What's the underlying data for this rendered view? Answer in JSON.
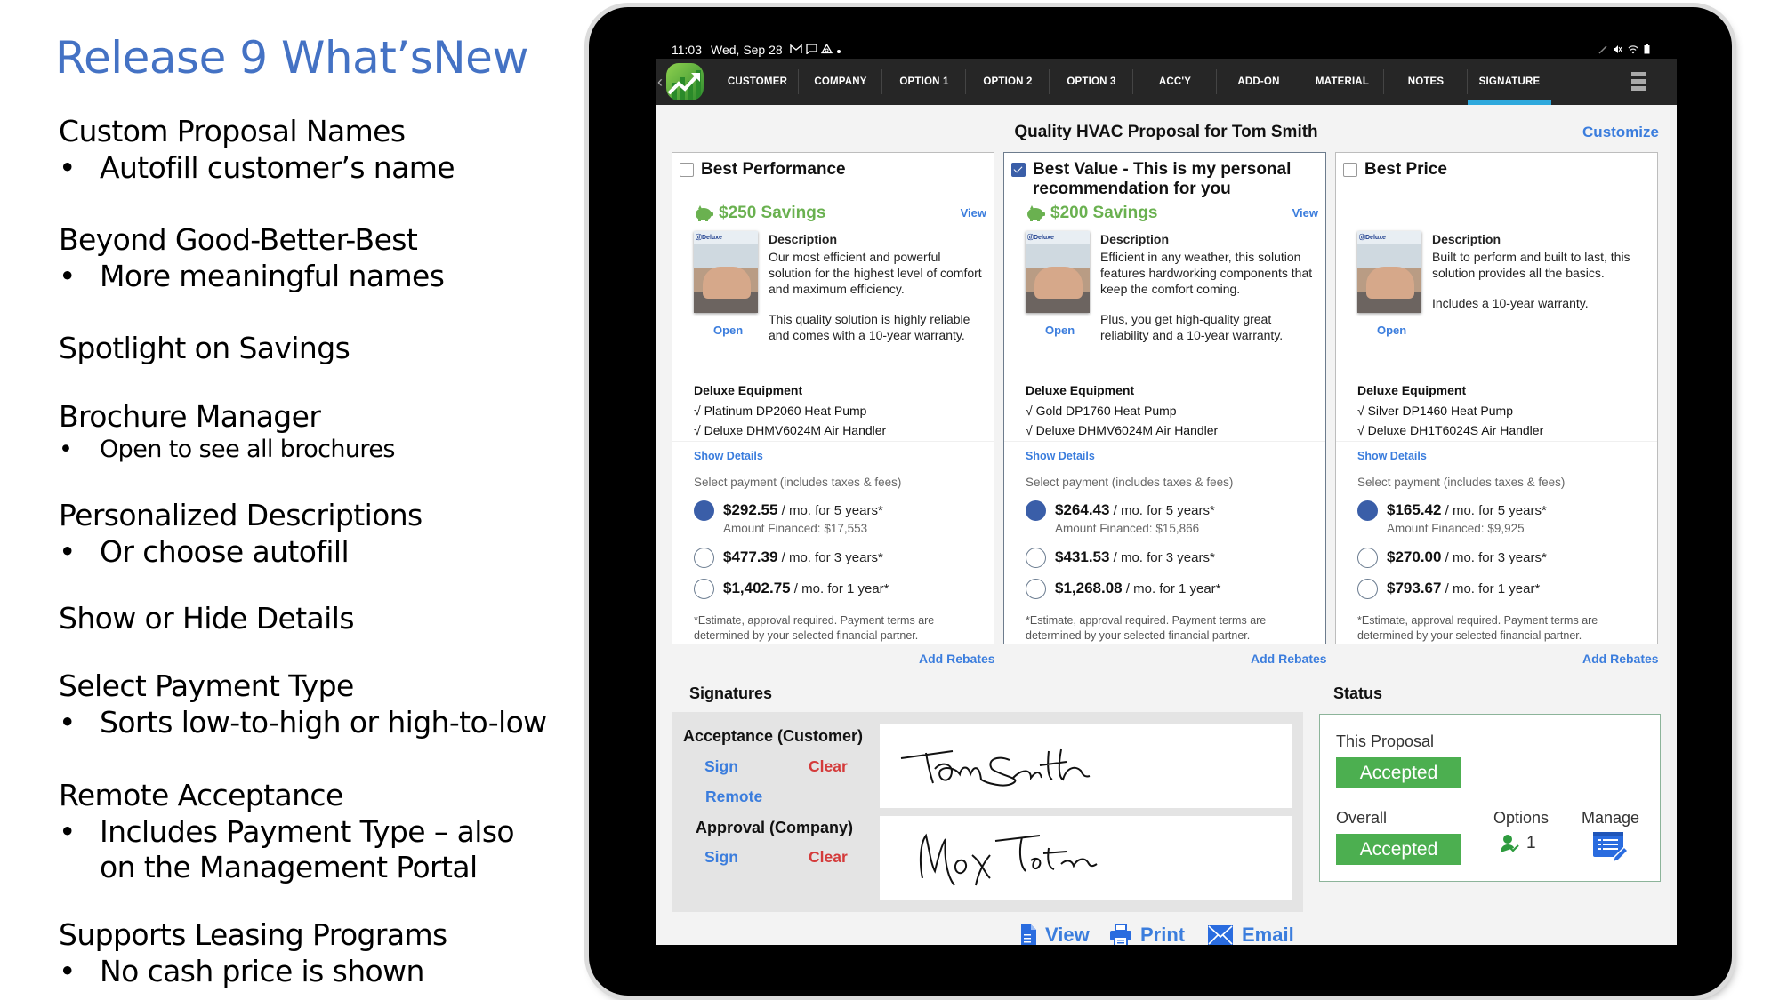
{
  "slide": {
    "title": "Release 9 What’sNew",
    "features": [
      {
        "heading": "Custom Proposal Names",
        "bullets": [
          "Autofill customer’s name"
        ]
      },
      {
        "heading": "Beyond Good-Better-Best",
        "bullets": [
          "More meaningful names"
        ]
      },
      {
        "heading": "Spotlight on Savings",
        "bullets": []
      },
      {
        "heading": "Brochure Manager",
        "bullets": [
          "Open to see all brochures"
        ]
      },
      {
        "heading": "Personalized Descriptions",
        "bullets": [
          "Or choose autofill"
        ]
      },
      {
        "heading": "Show or Hide Details",
        "bullets": []
      },
      {
        "heading": "Select Payment Type",
        "bullets": [
          "Sorts low-to-high or high-to-low"
        ]
      },
      {
        "heading": "Remote Acceptance",
        "bullets": [
          "Includes Payment Type – also on the Management Portal"
        ]
      },
      {
        "heading": "Supports Leasing Programs",
        "bullets": [
          "No cash price is shown"
        ]
      }
    ],
    "bullet_char": "•"
  },
  "device": {
    "status_bar": {
      "time": "11:03",
      "date": "Wed, Sep 28",
      "left_icons": [
        "gmail-icon",
        "message-icon",
        "drive-icon",
        "dot-icon"
      ],
      "right_icons": [
        "pen-icon",
        "mute-icon",
        "wifi-icon",
        "battery-icon"
      ]
    }
  },
  "app": {
    "nav": {
      "back_glyph": "‹",
      "tabs": [
        {
          "label": "CUSTOMER",
          "active": false
        },
        {
          "label": "COMPANY",
          "active": false
        },
        {
          "label": "OPTION 1",
          "active": false
        },
        {
          "label": "OPTION 2",
          "active": false
        },
        {
          "label": "OPTION 3",
          "active": false
        },
        {
          "label": "ACC'Y",
          "active": false
        },
        {
          "label": "ADD-ON",
          "active": false
        },
        {
          "label": "MATERIAL",
          "active": false
        },
        {
          "label": "NOTES",
          "active": false
        },
        {
          "label": "SIGNATURE",
          "active": true
        }
      ],
      "accent_color": "#2ea8dc"
    },
    "proposal_title": "Quality HVAC Proposal for Tom Smith",
    "customize_label": "Customize",
    "common": {
      "view_label": "View",
      "open_label": "Open",
      "description_heading": "Description",
      "equipment_heading": "Deluxe Equipment",
      "show_details_label": "Show Details",
      "select_payment_label": "Select payment (includes taxes & fees)",
      "estimate_note": "*Estimate, approval required. Payment terms are determined by your selected financial partner.",
      "add_rebates_label": "Add Rebates",
      "check_glyph": "√"
    },
    "options": [
      {
        "name": "Best Performance",
        "checked": false,
        "savings": "$250 Savings",
        "description": [
          "Our most efficient and powerful solution for the highest level of comfort and maximum efficiency.",
          "This quality solution is highly reliable and comes with a 10-year warranty."
        ],
        "equipment": [
          "Platinum DP2060 Heat Pump",
          "Deluxe DHMV6024M Air Handler"
        ],
        "payments": [
          {
            "amount": "$292.55",
            "term": " / mo. for 5 years*",
            "financed": "Amount Financed: $17,553",
            "selected": true
          },
          {
            "amount": "$477.39",
            "term": " / mo. for 3 years*",
            "financed": "",
            "selected": false
          },
          {
            "amount": "$1,402.75",
            "term": " / mo. for 1 year*",
            "financed": "",
            "selected": false
          }
        ]
      },
      {
        "name": "Best Value - This is my personal recommendation for you",
        "checked": true,
        "savings": "$200 Savings",
        "description": [
          "Efficient in any weather, this solution features hardworking components that keep the comfort coming.",
          "Plus, you get high-quality great reliability and a 10-year warranty."
        ],
        "equipment": [
          "Gold DP1760 Heat Pump",
          "Deluxe DHMV6024M Air Handler"
        ],
        "payments": [
          {
            "amount": "$264.43",
            "term": " / mo. for 5 years*",
            "financed": "Amount Financed: $15,866",
            "selected": true
          },
          {
            "amount": "$431.53",
            "term": " / mo. for 3 years*",
            "financed": "",
            "selected": false
          },
          {
            "amount": "$1,268.08",
            "term": " / mo. for 1 year*",
            "financed": "",
            "selected": false
          }
        ]
      },
      {
        "name": "Best Price",
        "checked": false,
        "savings": "",
        "description": [
          "Built to perform and built to last, this solution provides all the basics.",
          "Includes a 10-year warranty."
        ],
        "equipment": [
          "Silver DP1460 Heat Pump",
          "Deluxe DH1T6024S Air Handler"
        ],
        "payments": [
          {
            "amount": "$165.42",
            "term": " / mo. for 5 years*",
            "financed": "Amount Financed: $9,925",
            "selected": true
          },
          {
            "amount": "$270.00",
            "term": " / mo. for 3 years*",
            "financed": "",
            "selected": false
          },
          {
            "amount": "$793.67",
            "term": " / mo. for 1 year*",
            "financed": "",
            "selected": false
          }
        ]
      }
    ],
    "signatures": {
      "title": "Signatures",
      "customer": {
        "label": "Acceptance (Customer)",
        "sign": "Sign",
        "clear": "Clear",
        "remote": "Remote",
        "signed_name": "Tom Smith"
      },
      "company": {
        "label": "Approval (Company)",
        "sign": "Sign",
        "clear": "Clear",
        "signed_name": "Max Tetra"
      }
    },
    "status": {
      "title": "Status",
      "this_proposal_label": "This Proposal",
      "this_proposal_value": "Accepted",
      "overall_label": "Overall",
      "overall_value": "Accepted",
      "options_label": "Options",
      "options_count": "1",
      "manage_label": "Manage",
      "accepted_color": "#4caf50"
    },
    "actions": {
      "view": "View",
      "print": "Print",
      "email": "Email"
    }
  }
}
